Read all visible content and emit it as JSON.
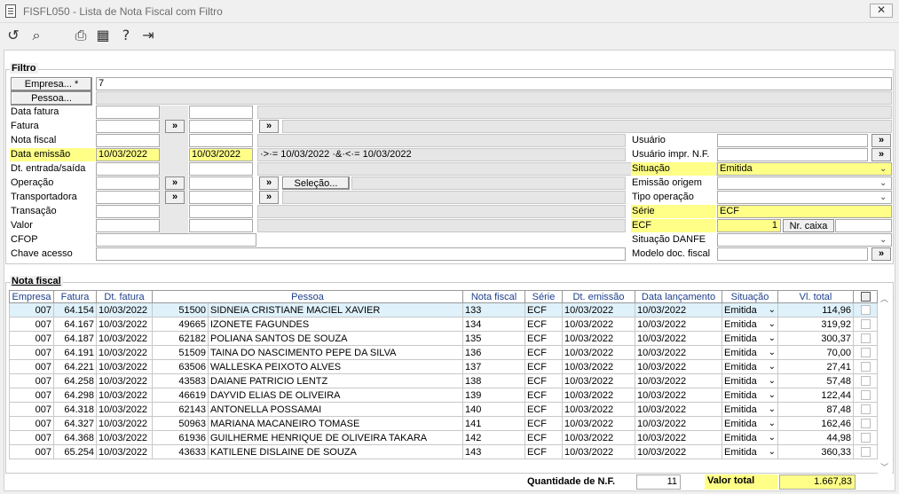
{
  "window": {
    "title": "FISFL050 - Lista de Nota Fiscal com Filtro",
    "close_label": "✕"
  },
  "toolbar": [
    {
      "name": "refresh-icon",
      "glyph": "↺"
    },
    {
      "name": "search-icon",
      "glyph": "⌕"
    },
    {
      "name": "print-icon",
      "glyph": "⎙"
    },
    {
      "name": "calendar-icon",
      "glyph": "▦"
    },
    {
      "name": "help-icon",
      "glyph": "?"
    },
    {
      "name": "exit-icon",
      "glyph": "⇥"
    }
  ],
  "filtro": {
    "legend": "Filtro",
    "empresa_btn": "Empresa... *",
    "empresa_value": "7",
    "pessoa_btn": "Pessoa...",
    "labels": {
      "data_fatura": "Data fatura",
      "fatura": "Fatura",
      "nota_fiscal": "Nota fiscal",
      "data_emissao": "Data emissão",
      "dt_entrada": "Dt. entrada/saída",
      "operacao": "Operação",
      "transportadora": "Transportadora",
      "transacao": "Transação",
      "valor": "Valor",
      "cfop": "CFOP",
      "chave_acesso": "Chave acesso"
    },
    "data_emissao_from": "10/03/2022",
    "data_emissao_to": "10/03/2022",
    "data_emissao_expr": "·>·= 10/03/2022 ·&·<·= 10/03/2022",
    "arrow": "»",
    "selecao_btn": "Seleção...",
    "right": {
      "usuario": "Usuário",
      "usuario_impr": "Usuário impr. N.F.",
      "situacao": "Situação",
      "situacao_value": "Emitida",
      "emissao_origem": "Emissão origem",
      "tipo_operacao": "Tipo operação",
      "serie": "Série",
      "serie_value": "ECF",
      "ecf": "ECF",
      "ecf_value": "1",
      "nr_caixa": "Nr. caixa",
      "situacao_danfe": "Situação DANFE",
      "modelo_doc": "Modelo doc. fiscal"
    }
  },
  "nota_fiscal": {
    "legend": "Nota fiscal",
    "columns": [
      "Empresa",
      "Fatura",
      "Dt. fatura",
      "Pessoa",
      "Nota fiscal",
      "Série",
      "Dt. emissão",
      "Data lançamento",
      "Situação",
      "Vl. total"
    ],
    "rows": [
      {
        "empresa": "007",
        "fatura": "64.154",
        "dt_fatura": "10/03/2022",
        "pessoa_cod": "51500",
        "pessoa": "SIDNEIA CRISTIANE MACIEL XAVIER",
        "nf": "133",
        "serie": "ECF",
        "dt_emissao": "10/03/2022",
        "dt_lanc": "10/03/2022",
        "situacao": "Emitida",
        "vl_total": "114,96"
      },
      {
        "empresa": "007",
        "fatura": "64.167",
        "dt_fatura": "10/03/2022",
        "pessoa_cod": "49665",
        "pessoa": "IZONETE FAGUNDES",
        "nf": "134",
        "serie": "ECF",
        "dt_emissao": "10/03/2022",
        "dt_lanc": "10/03/2022",
        "situacao": "Emitida",
        "vl_total": "319,92"
      },
      {
        "empresa": "007",
        "fatura": "64.187",
        "dt_fatura": "10/03/2022",
        "pessoa_cod": "62182",
        "pessoa": "POLIANA SANTOS DE SOUZA",
        "nf": "135",
        "serie": "ECF",
        "dt_emissao": "10/03/2022",
        "dt_lanc": "10/03/2022",
        "situacao": "Emitida",
        "vl_total": "300,37"
      },
      {
        "empresa": "007",
        "fatura": "64.191",
        "dt_fatura": "10/03/2022",
        "pessoa_cod": "51509",
        "pessoa": "TAINA DO NASCIMENTO PEPE DA SILVA",
        "nf": "136",
        "serie": "ECF",
        "dt_emissao": "10/03/2022",
        "dt_lanc": "10/03/2022",
        "situacao": "Emitida",
        "vl_total": "70,00"
      },
      {
        "empresa": "007",
        "fatura": "64.221",
        "dt_fatura": "10/03/2022",
        "pessoa_cod": "63506",
        "pessoa": "WALLESKA PEIXOTO ALVES",
        "nf": "137",
        "serie": "ECF",
        "dt_emissao": "10/03/2022",
        "dt_lanc": "10/03/2022",
        "situacao": "Emitida",
        "vl_total": "27,41"
      },
      {
        "empresa": "007",
        "fatura": "64.258",
        "dt_fatura": "10/03/2022",
        "pessoa_cod": "43583",
        "pessoa": "DAIANE PATRICIO LENTZ",
        "nf": "138",
        "serie": "ECF",
        "dt_emissao": "10/03/2022",
        "dt_lanc": "10/03/2022",
        "situacao": "Emitida",
        "vl_total": "57,48"
      },
      {
        "empresa": "007",
        "fatura": "64.298",
        "dt_fatura": "10/03/2022",
        "pessoa_cod": "46619",
        "pessoa": "DAYVID ELIAS DE OLIVEIRA",
        "nf": "139",
        "serie": "ECF",
        "dt_emissao": "10/03/2022",
        "dt_lanc": "10/03/2022",
        "situacao": "Emitida",
        "vl_total": "122,44"
      },
      {
        "empresa": "007",
        "fatura": "64.318",
        "dt_fatura": "10/03/2022",
        "pessoa_cod": "62143",
        "pessoa": "ANTONELLA POSSAMAI",
        "nf": "140",
        "serie": "ECF",
        "dt_emissao": "10/03/2022",
        "dt_lanc": "10/03/2022",
        "situacao": "Emitida",
        "vl_total": "87,48"
      },
      {
        "empresa": "007",
        "fatura": "64.327",
        "dt_fatura": "10/03/2022",
        "pessoa_cod": "50963",
        "pessoa": "MARIANA MACANEIRO TOMASE",
        "nf": "141",
        "serie": "ECF",
        "dt_emissao": "10/03/2022",
        "dt_lanc": "10/03/2022",
        "situacao": "Emitida",
        "vl_total": "162,46"
      },
      {
        "empresa": "007",
        "fatura": "64.368",
        "dt_fatura": "10/03/2022",
        "pessoa_cod": "61936",
        "pessoa": "GUILHERME HENRIQUE DE OLIVEIRA TAKARA",
        "nf": "142",
        "serie": "ECF",
        "dt_emissao": "10/03/2022",
        "dt_lanc": "10/03/2022",
        "situacao": "Emitida",
        "vl_total": "44,98"
      },
      {
        "empresa": "007",
        "fatura": "65.254",
        "dt_fatura": "10/03/2022",
        "pessoa_cod": "43633",
        "pessoa": "KATILENE DISLAINE DE SOUZA",
        "nf": "143",
        "serie": "ECF",
        "dt_emissao": "10/03/2022",
        "dt_lanc": "10/03/2022",
        "situacao": "Emitida",
        "vl_total": "360,33"
      }
    ]
  },
  "footer": {
    "quantidade_label": "Quantidade de N.F.",
    "quantidade_value": "11",
    "valor_total_label": "Valor total",
    "valor_total_value": "1.667,83"
  },
  "colors": {
    "highlight": "#ffff88",
    "selected_row": "#dff1fa",
    "header_text": "#1f3f8a"
  }
}
